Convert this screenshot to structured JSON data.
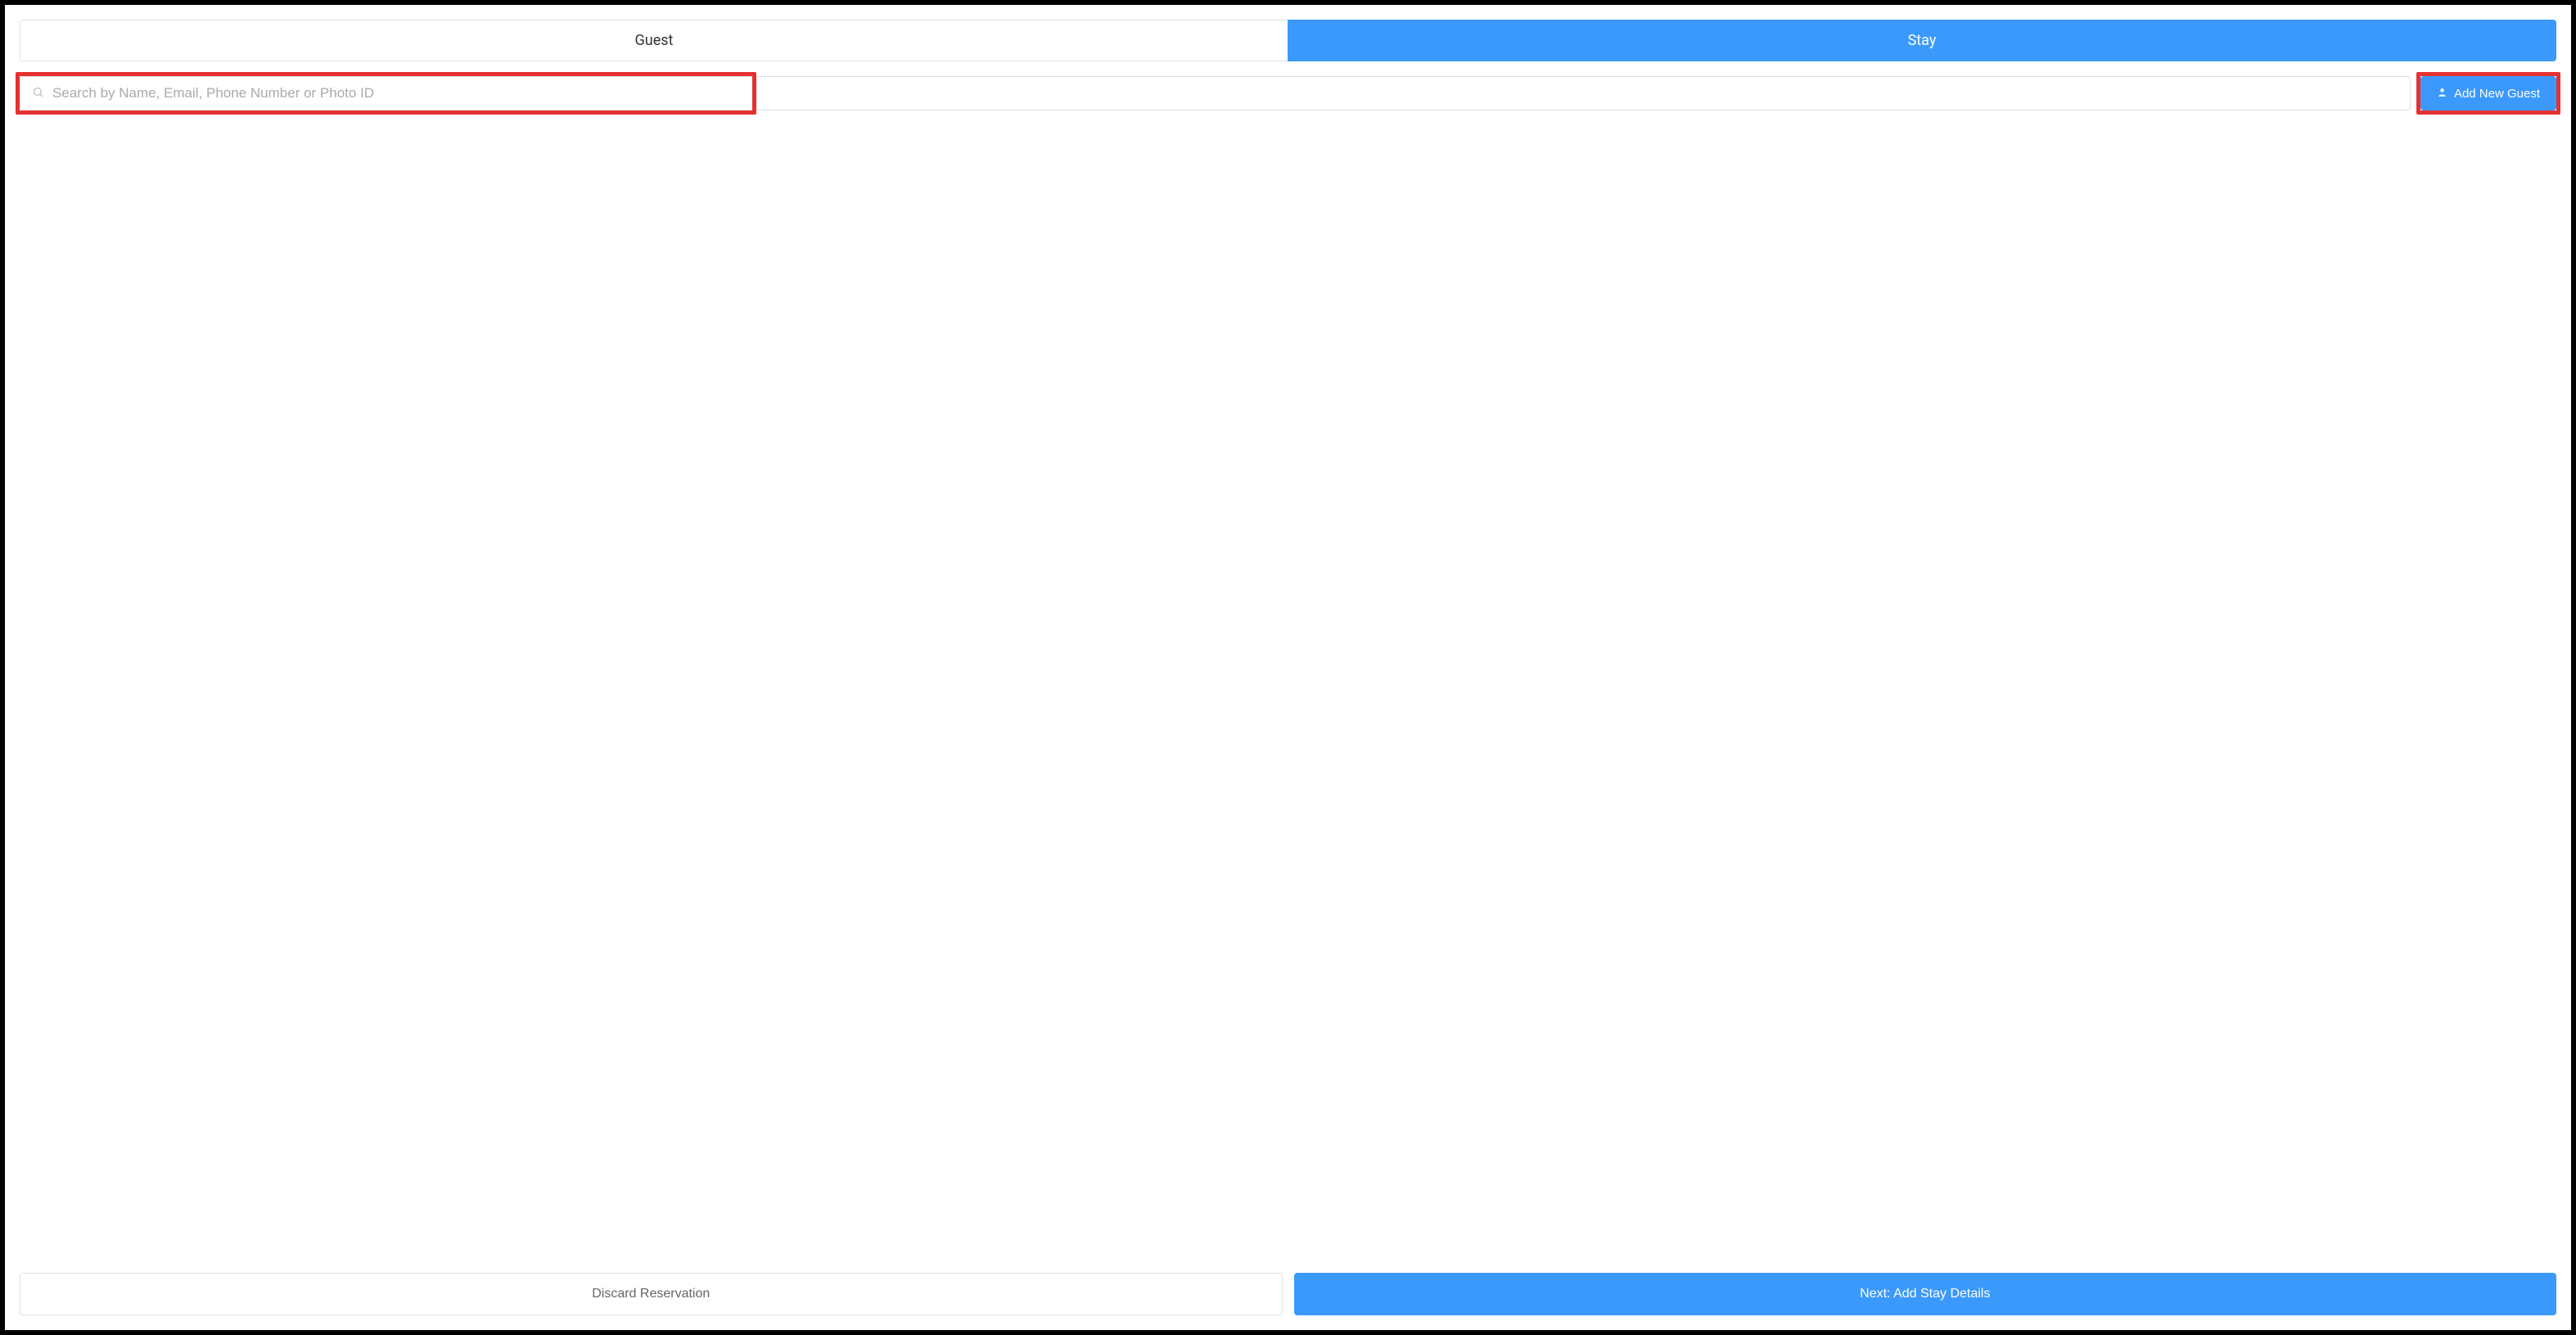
{
  "tabs": {
    "guest_label": "Guest",
    "stay_label": "Stay"
  },
  "search": {
    "placeholder": "Search by Name, Email, Phone Number or Photo ID",
    "value": ""
  },
  "buttons": {
    "add_new_guest": "Add New Guest",
    "discard_reservation": "Discard Reservation",
    "next_add_stay": "Next: Add Stay Details"
  }
}
